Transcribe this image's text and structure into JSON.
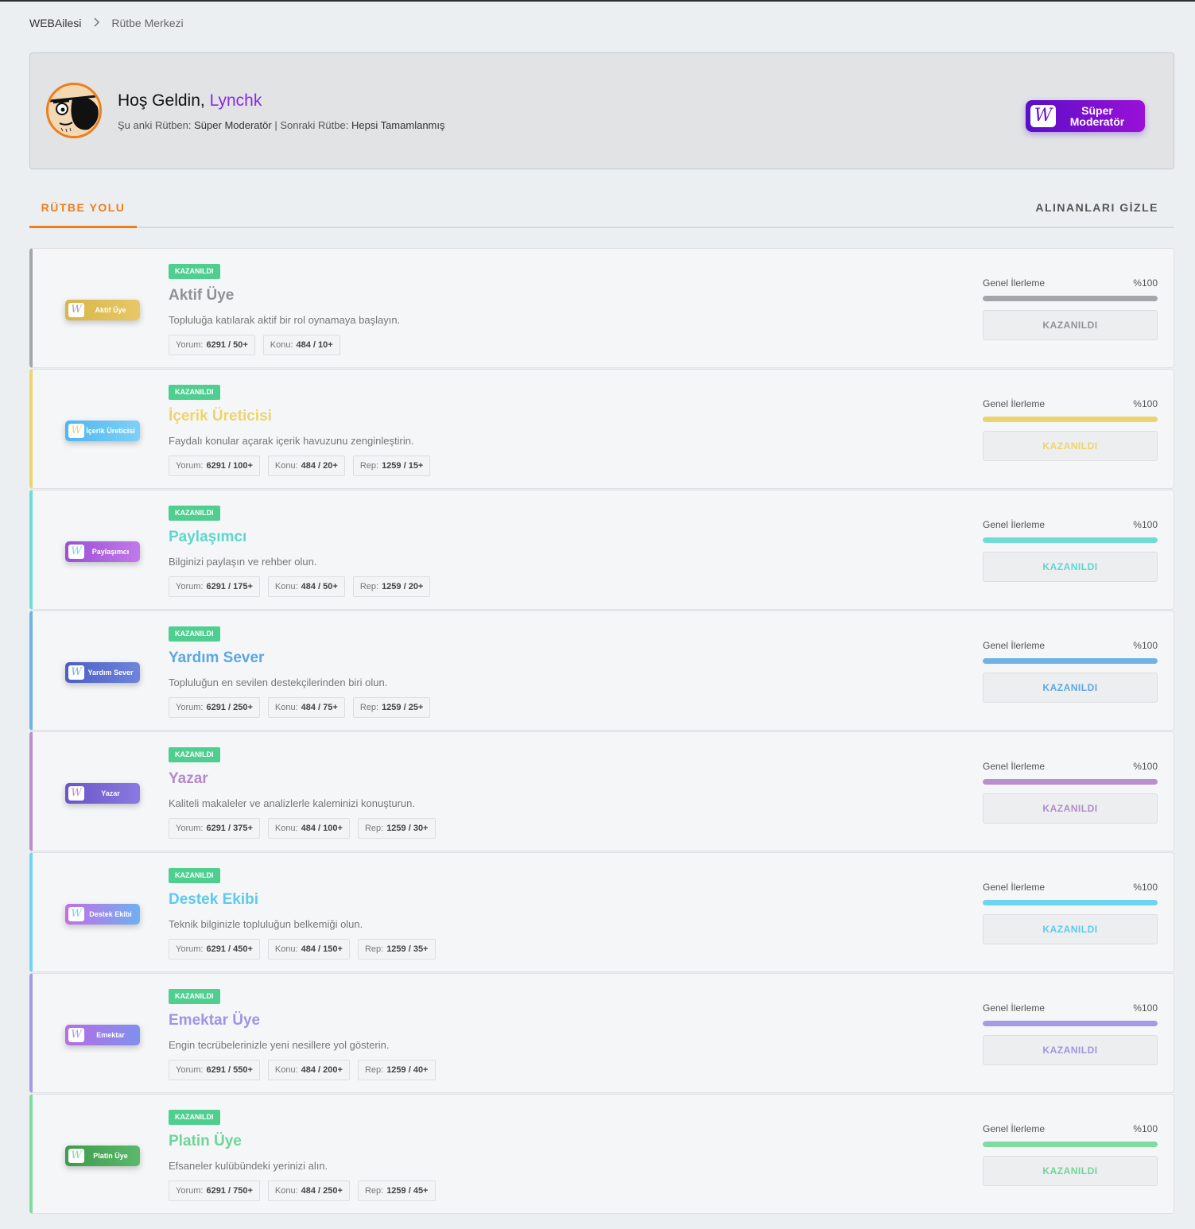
{
  "breadcrumb": {
    "home": "WEBAilesi",
    "current": "Rütbe Merkezi"
  },
  "welcome": {
    "greeting": "Hoş Geldin,",
    "username": "Lynchk",
    "current_rank_label": "Şu anki Rütben:",
    "current_rank": "Süper Moderatör",
    "separator": "|",
    "next_rank_label": "Sonraki Rütbe:",
    "next_rank": "Hepsi Tamamlanmış",
    "badge_text": "Süper Moderatör",
    "badge_letter": "W"
  },
  "tabs": {
    "active": "RÜTBE YOLU",
    "hide_earned": "ALINANLARI GİZLE"
  },
  "common": {
    "earned_tag": "KAZANILDI",
    "progress_label": "Genel İlerleme",
    "button_label": "KAZANILDI",
    "badge_letter": "W"
  },
  "ranks": [
    {
      "title": "Aktif Üye",
      "desc": "Topluluğa katılarak aktif bir rol oynamaya başlayın.",
      "badge": "Aktif Üye",
      "color": "#a3a6aa",
      "title_color": "#8f9296",
      "badge_bg": "linear-gradient(90deg,#d9b54a,#e8c866)",
      "progress": "%100",
      "progress_value": 100,
      "reqs": [
        {
          "label": "Yorum:",
          "value": "6291 / 50+"
        },
        {
          "label": "Konu:",
          "value": "484 / 10+"
        }
      ]
    },
    {
      "title": "İçerik Üreticisi",
      "desc": "Faydalı konular açarak içerik havuzunu zenginleştirin.",
      "badge": "İçerik Üreticisi",
      "color": "#ecd46e",
      "title_color": "#ecd46e",
      "badge_bg": "linear-gradient(90deg,#4fb6f0,#7fd0f7)",
      "progress": "%100",
      "progress_value": 100,
      "reqs": [
        {
          "label": "Yorum:",
          "value": "6291 / 100+"
        },
        {
          "label": "Konu:",
          "value": "484 / 20+"
        },
        {
          "label": "Rep:",
          "value": "1259 / 15+"
        }
      ]
    },
    {
      "title": "Paylaşımcı",
      "desc": "Bilginizi paylaşın ve rehber olun.",
      "badge": "Paylaşımcı",
      "color": "#6fdcd6",
      "title_color": "#5dd6d0",
      "badge_bg": "linear-gradient(90deg,#9b4fd6,#c17ae8)",
      "progress": "%100",
      "progress_value": 100,
      "reqs": [
        {
          "label": "Yorum:",
          "value": "6291 / 175+"
        },
        {
          "label": "Konu:",
          "value": "484 / 50+"
        },
        {
          "label": "Rep:",
          "value": "1259 / 20+"
        }
      ]
    },
    {
      "title": "Yardım Sever",
      "desc": "Topluluğun en sevilen destekçilerinden biri olun.",
      "badge": "Yardım Sever",
      "color": "#6fb2e6",
      "title_color": "#5aa8e3",
      "badge_bg": "linear-gradient(90deg,#4a5fc4,#6f84dc)",
      "progress": "%100",
      "progress_value": 100,
      "reqs": [
        {
          "label": "Yorum:",
          "value": "6291 / 250+"
        },
        {
          "label": "Konu:",
          "value": "484 / 75+"
        },
        {
          "label": "Rep:",
          "value": "1259 / 25+"
        }
      ]
    },
    {
      "title": "Yazar",
      "desc": "Kaliteli makaleler ve analizlerle kaleminizi konuşturun.",
      "badge": "Yazar",
      "color": "#b98fcf",
      "title_color": "#b38bcb",
      "badge_bg": "linear-gradient(90deg,#6a55c8,#8a7ae0)",
      "progress": "%100",
      "progress_value": 100,
      "reqs": [
        {
          "label": "Yorum:",
          "value": "6291 / 375+"
        },
        {
          "label": "Konu:",
          "value": "484 / 100+"
        },
        {
          "label": "Rep:",
          "value": "1259 / 30+"
        }
      ]
    },
    {
      "title": "Destek Ekibi",
      "desc": "Teknik bilginizle topluluğun belkemiği olun.",
      "badge": "Destek Ekibi",
      "color": "#6fd4ef",
      "title_color": "#5ccbea",
      "badge_bg": "linear-gradient(90deg,#c36ee6,#6fb0f0)",
      "progress": "%100",
      "progress_value": 100,
      "reqs": [
        {
          "label": "Yorum:",
          "value": "6291 / 450+"
        },
        {
          "label": "Konu:",
          "value": "484 / 150+"
        },
        {
          "label": "Rep:",
          "value": "1259 / 35+"
        }
      ]
    },
    {
      "title": "Emektar Üye",
      "desc": "Engin tecrübelerinizle yeni nesillere yol gösterin.",
      "badge": "Emektar",
      "color": "#a49be6",
      "title_color": "#9f95e2",
      "badge_bg": "linear-gradient(90deg,#b56ee4,#7f90ee)",
      "progress": "%100",
      "progress_value": 100,
      "reqs": [
        {
          "label": "Yorum:",
          "value": "6291 / 550+"
        },
        {
          "label": "Konu:",
          "value": "484 / 200+"
        },
        {
          "label": "Rep:",
          "value": "1259 / 40+"
        }
      ]
    },
    {
      "title": "Platin Üye",
      "desc": "Efsaneler kulübündeki yerinizi alın.",
      "badge": "Platin Üye",
      "color": "#7fdba0",
      "title_color": "#6ed596",
      "badge_bg": "linear-gradient(90deg,#3e9a4c,#5cb86a)",
      "progress": "%100",
      "progress_value": 100,
      "reqs": [
        {
          "label": "Yorum:",
          "value": "6291 / 750+"
        },
        {
          "label": "Konu:",
          "value": "484 / 250+"
        },
        {
          "label": "Rep:",
          "value": "1259 / 45+"
        }
      ]
    }
  ]
}
